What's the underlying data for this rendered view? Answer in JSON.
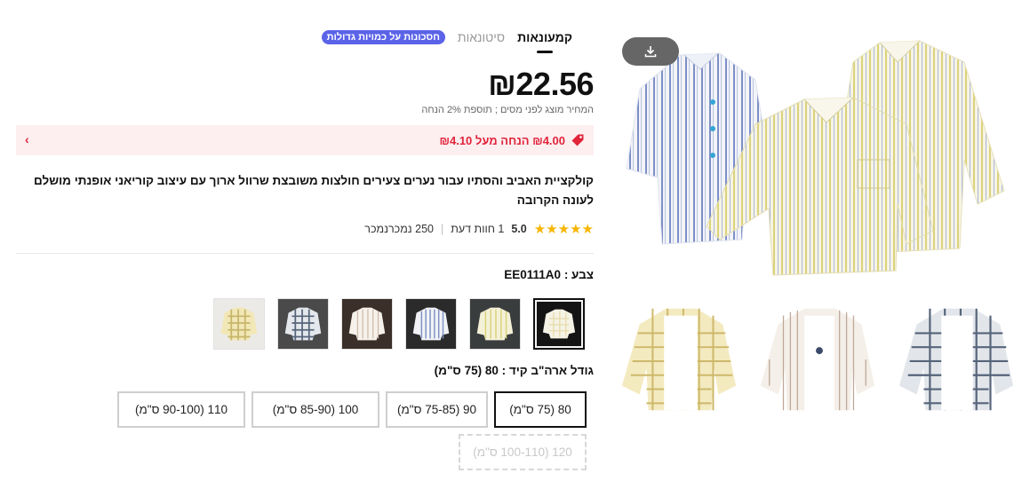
{
  "tabs": [
    {
      "label": "קמעונאות",
      "active": true
    },
    {
      "label": "סיטונאות",
      "active": false
    }
  ],
  "bulk_badge": "חסכונות על כמויות גדולות",
  "price": "₪22.56",
  "tax_note": "המחיר מוצג לפני מסים ; תוספת 2% הנחה",
  "discount": {
    "text": "₪4.00 הנחה מעל ₪4.10",
    "icon": "tag-icon",
    "chevron": "›",
    "color": "#e1243a"
  },
  "product_title": "קולקציית האביב והסתיו עבור נערים צעירים חולצות משובצת שרוול ארוך עם עיצוב קוריאני אופנתי מושלם לעונה הקרובה",
  "rating": {
    "stars": "★★★★★",
    "value": "5.0",
    "reviews": "1 חוות דעת",
    "separator": "|",
    "sold": "250 נמכרנמכר"
  },
  "color_label": "צבע : EE0111A0",
  "colors": [
    {
      "name": "white-yellow plaid",
      "selected": true
    },
    {
      "name": "yellow stripe",
      "selected": false
    },
    {
      "name": "blue stripe",
      "selected": false
    },
    {
      "name": "cream stripe",
      "selected": false
    },
    {
      "name": "grey plaid",
      "selected": false
    },
    {
      "name": "yellow plaid",
      "selected": false
    }
  ],
  "size_label": "גודל ארה\"ב קיד : 80 (75 ס\"מ)",
  "sizes": [
    {
      "label": "80 (75 ס\"מ)",
      "selected": true,
      "disabled": false
    },
    {
      "label": "90 (75-85 ס\"מ)",
      "selected": false,
      "disabled": false
    },
    {
      "label": "100 (85-90 ס\"מ)",
      "selected": false,
      "disabled": false
    },
    {
      "label": "110 (90-100 ס\"מ)",
      "selected": false,
      "disabled": false
    },
    {
      "label": "120 (100-110 ס\"מ)",
      "selected": false,
      "disabled": true
    }
  ],
  "gallery": {
    "download_icon": "download-icon"
  }
}
